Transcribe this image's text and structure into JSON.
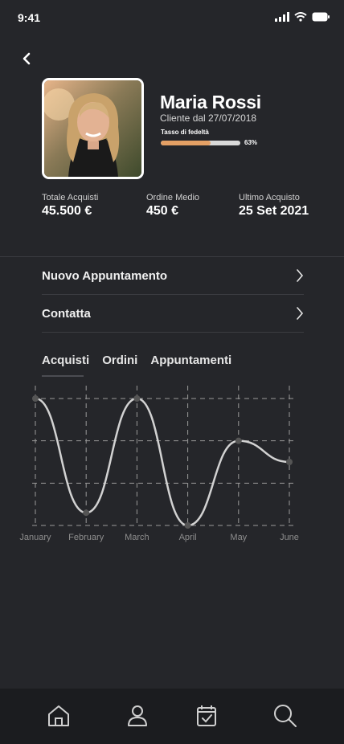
{
  "status_bar": {
    "time": "9:41"
  },
  "profile": {
    "name": "Maria Rossi",
    "since": "Cliente dal 27/07/2018",
    "loyalty": {
      "label": "Tasso di fedeltà",
      "value": 63,
      "percent_text": "63%"
    }
  },
  "stats": [
    {
      "label": "Totale Acquisti",
      "value": "45.500 €"
    },
    {
      "label": "Ordine Medio",
      "value": "450 €"
    },
    {
      "label": "Ultimo Acquisto",
      "value": "25 Set 2021"
    }
  ],
  "menu": [
    {
      "label": "Nuovo Appuntamento"
    },
    {
      "label": "Contatta"
    }
  ],
  "tabs": [
    {
      "label": "Acquisti",
      "active": true
    },
    {
      "label": "Ordini",
      "active": false
    },
    {
      "label": "Appuntamenti",
      "active": false
    }
  ],
  "chart_data": {
    "type": "line",
    "categories": [
      "January",
      "February",
      "March",
      "April",
      "May",
      "June"
    ],
    "values": [
      3.8,
      1.1,
      3.8,
      0.8,
      2.8,
      2.3
    ],
    "ylim": [
      0.8,
      3.8
    ],
    "grid": true,
    "line_color": "#d2d2d2"
  },
  "bottom_nav": [
    {
      "icon": "home-icon"
    },
    {
      "icon": "user-icon"
    },
    {
      "icon": "calendar-icon"
    },
    {
      "icon": "search-icon"
    }
  ],
  "colors": {
    "background": "#25262a",
    "tabbar": "#1b1c1f",
    "accent": "#e4a065"
  }
}
